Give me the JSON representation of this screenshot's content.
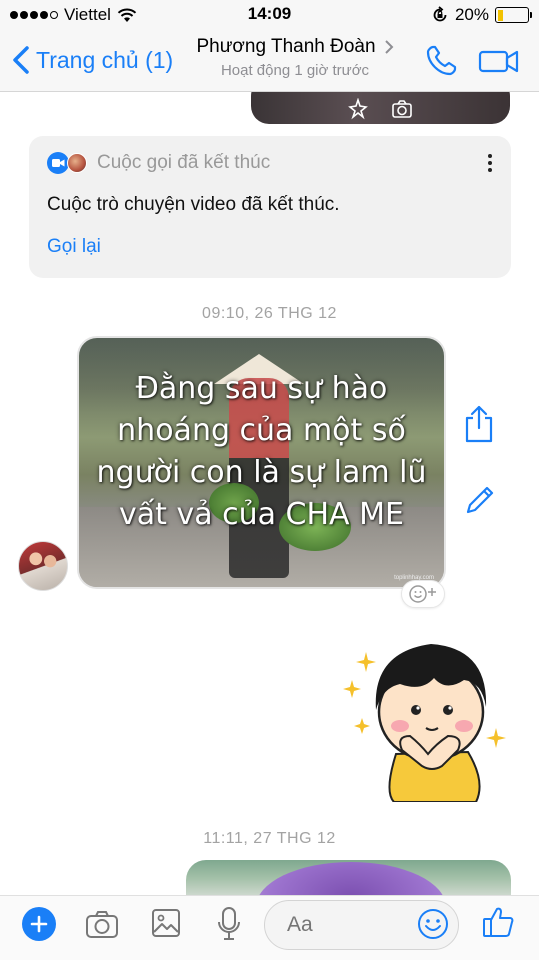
{
  "status_bar": {
    "carrier": "Viettel",
    "time": "14:09",
    "battery_percent": "20%",
    "battery_level": 0.2,
    "signal_bars_filled": 4,
    "signal_bars_total": 5,
    "battery_color": "#f2c200"
  },
  "nav": {
    "back_label": "Trang chủ (1)",
    "title": "Phương Thanh Đoàn",
    "subtitle": "Hoạt động 1 giờ trước",
    "accent_color": "#1a7ff7",
    "icons": [
      "chevron-left-icon",
      "phone-icon",
      "video-camera-icon"
    ]
  },
  "call_card": {
    "header": "Cuộc gọi đã kết thúc",
    "description": "Cuộc trò chuyện video đã kết thúc.",
    "action": "Gọi lại"
  },
  "messages": {
    "timestamp_1": "09:10, 26 THG 12",
    "image_caption": "Đằng sau sự hào nhoáng của một số người con là sự lam lũ vất vả của CHA ME",
    "image_watermark": "toplinhhay.com",
    "timestamp_2": "11:11, 27 THG 12"
  },
  "composer": {
    "placeholder": "Aa",
    "icons": [
      "plus-icon",
      "camera-icon",
      "image-icon",
      "microphone-icon",
      "smiley-icon",
      "thumbs-up-icon"
    ]
  }
}
